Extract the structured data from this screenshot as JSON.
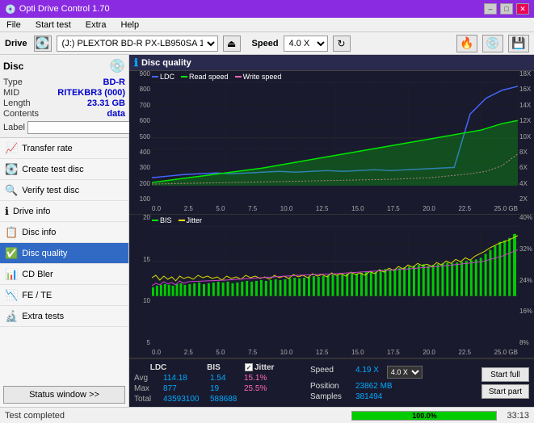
{
  "app": {
    "title": "Opti Drive Control 1.70",
    "title_icon": "💿"
  },
  "title_buttons": {
    "minimize": "–",
    "maximize": "□",
    "close": "✕"
  },
  "menu": {
    "items": [
      "File",
      "Start test",
      "Extra",
      "Help"
    ]
  },
  "drive_bar": {
    "drive_label": "Drive",
    "drive_value": "(J:)  PLEXTOR BD-R  PX-LB950SA 1.06",
    "eject_icon": "⏏",
    "speed_label": "Speed",
    "speed_value": "4.0 X",
    "refresh_icon": "↻"
  },
  "disc_panel": {
    "title": "Disc",
    "rows": [
      {
        "key": "Type",
        "value": "BD-R",
        "colored": true
      },
      {
        "key": "MID",
        "value": "RITEKBR3 (000)",
        "colored": true
      },
      {
        "key": "Length",
        "value": "23.31 GB",
        "colored": true
      },
      {
        "key": "Contents",
        "value": "data",
        "colored": true
      }
    ],
    "label_key": "Label"
  },
  "nav_items": [
    {
      "id": "transfer-rate",
      "label": "Transfer rate",
      "icon": "📈",
      "active": false
    },
    {
      "id": "create-test-disc",
      "label": "Create test disc",
      "icon": "💽",
      "active": false
    },
    {
      "id": "verify-test-disc",
      "label": "Verify test disc",
      "icon": "🔍",
      "active": false
    },
    {
      "id": "drive-info",
      "label": "Drive info",
      "icon": "ℹ",
      "active": false
    },
    {
      "id": "disc-info",
      "label": "Disc info",
      "icon": "📋",
      "active": false
    },
    {
      "id": "disc-quality",
      "label": "Disc quality",
      "icon": "✅",
      "active": true
    },
    {
      "id": "cd-bler",
      "label": "CD Bler",
      "icon": "📊",
      "active": false
    },
    {
      "id": "fe-te",
      "label": "FE / TE",
      "icon": "📉",
      "active": false
    },
    {
      "id": "extra-tests",
      "label": "Extra tests",
      "icon": "🔬",
      "active": false
    }
  ],
  "status_btn": "Status window >>",
  "disc_quality": {
    "header": "Disc quality",
    "chart1": {
      "legend": [
        {
          "label": "LDC",
          "color": "#4444ff"
        },
        {
          "label": "Read speed",
          "color": "#00ff00"
        },
        {
          "label": "Write speed",
          "color": "#ff69b4"
        }
      ],
      "y_labels_left": [
        "900",
        "800",
        "700",
        "600",
        "500",
        "400",
        "300",
        "200",
        "100"
      ],
      "y_labels_right": [
        "18X",
        "16X",
        "14X",
        "12X",
        "10X",
        "8X",
        "6X",
        "4X",
        "2X"
      ],
      "x_labels": [
        "0.0",
        "2.5",
        "5.0",
        "7.5",
        "10.0",
        "12.5",
        "15.0",
        "17.5",
        "20.0",
        "22.5",
        "25.0 GB"
      ]
    },
    "chart2": {
      "legend": [
        {
          "label": "BIS",
          "color": "#00ff00"
        },
        {
          "label": "Jitter",
          "color": "#ffff00"
        }
      ],
      "y_labels_left": [
        "20",
        "15",
        "10",
        "5"
      ],
      "y_labels_right": [
        "40%",
        "32%",
        "24%",
        "16%",
        "8%"
      ],
      "x_labels": [
        "0.0",
        "2.5",
        "5.0",
        "7.5",
        "10.0",
        "12.5",
        "15.0",
        "17.5",
        "20.0",
        "22.5",
        "25.0 GB"
      ]
    }
  },
  "stats": {
    "ldc_label": "LDC",
    "bis_label": "BIS",
    "jitter_label": "Jitter",
    "jitter_checked": true,
    "speed_label": "Speed",
    "rows": [
      {
        "key": "Avg",
        "ldc": "114.18",
        "bis": "1.54",
        "jitter": "15.1%"
      },
      {
        "key": "Max",
        "ldc": "877",
        "bis": "19",
        "jitter": "25.5%"
      },
      {
        "key": "Total",
        "ldc": "43593100",
        "bis": "588688",
        "jitter": ""
      }
    ],
    "speed_value": "4.19 X",
    "speed_select": "4.0 X",
    "position_label": "Position",
    "position_value": "23862 MB",
    "samples_label": "Samples",
    "samples_value": "381494",
    "btn_start_full": "Start full",
    "btn_start_part": "Start part"
  },
  "status_bar": {
    "text": "Test completed",
    "progress": "100.0%",
    "time": "33:13"
  }
}
